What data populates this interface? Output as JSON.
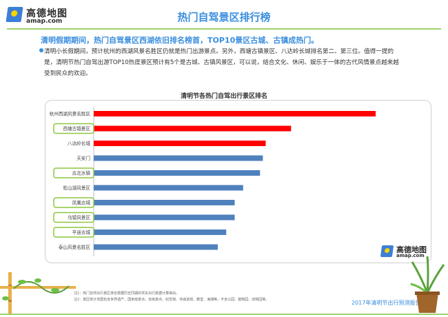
{
  "header": {
    "logo_name": "高德地图",
    "logo_url": "amap.com",
    "title": "热门自驾景区排行榜"
  },
  "headline": "清明假期期间，热门自驾景区西湖依旧排名榜首，TOP10景区古城、古镇成热门。",
  "paragraph": "清明小长假期间，预计杭州的西湖风景名胜区仍就是热门出游景点。另外，西塘古镇景区、八达岭长城排名第二、第三位。值得一提的是，清明节热门自驾出游TOP10热度景区预计有5个是古城、古镇风景区，可以说，结合文化、休闲、娱乐于一体的古代风情景点越来越受到民众的欢迎。",
  "chart_data": {
    "type": "bar",
    "orientation": "horizontal",
    "title": "清明节各热门自驾出行景区排名",
    "categories": [
      "杭州西湖风景名胜区",
      "西塘古镇景区",
      "八达岭长城",
      "天安门",
      "古北水镇",
      "松山湖风景区",
      "凤凰古城",
      "乌镇风景区",
      "平遥古城",
      "泰山风景名胜区"
    ],
    "values": [
      100,
      70,
      61,
      60,
      59,
      53,
      50,
      50,
      47,
      44
    ],
    "highlighted": [
      false,
      true,
      false,
      false,
      true,
      false,
      true,
      true,
      true,
      false
    ],
    "bar_colors": [
      "#ff0000",
      "#ff0000",
      "#ff0000",
      "#4f81bd",
      "#4f81bd",
      "#4f81bd",
      "#4f81bd",
      "#4f81bd",
      "#4f81bd",
      "#4f81bd"
    ],
    "xlim": [
      0,
      100
    ]
  },
  "watermark": {
    "name": "高德地图",
    "url": "amap.com"
  },
  "notes": [
    "注1：热门自驾出行景区排名根据历史同期的驾车出行数据计算得出。",
    "注2：景区统计范围包含世界遗产、国家级景点、省级景点、纪念馆、寺庙道观、教堂、海滩等，不含公园、植物园、动物园等。"
  ],
  "footer": "2017年清明节出行预测报告",
  "colors": {
    "accent_blue": "#3a8ede",
    "accent_green": "#9ed06a",
    "red": "#ff0000",
    "blue_bar": "#4f81bd"
  }
}
